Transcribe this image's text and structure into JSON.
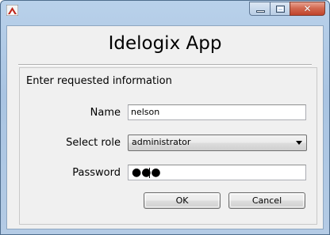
{
  "window": {
    "app_icon": "idelogix-app-icon",
    "controls": {
      "minimize_icon": "minimize-icon",
      "maximize_icon": "maximize-icon",
      "close_glyph": "✕"
    }
  },
  "dialog": {
    "title": "Idelogix App",
    "prompt": "Enter requested information",
    "fields": {
      "name": {
        "label": "Name",
        "value": "nelson"
      },
      "role": {
        "label": "Select role",
        "value": "administrator"
      },
      "password": {
        "label": "Password",
        "masked_value": "●●●"
      }
    },
    "buttons": {
      "ok": "OK",
      "cancel": "Cancel"
    }
  }
}
